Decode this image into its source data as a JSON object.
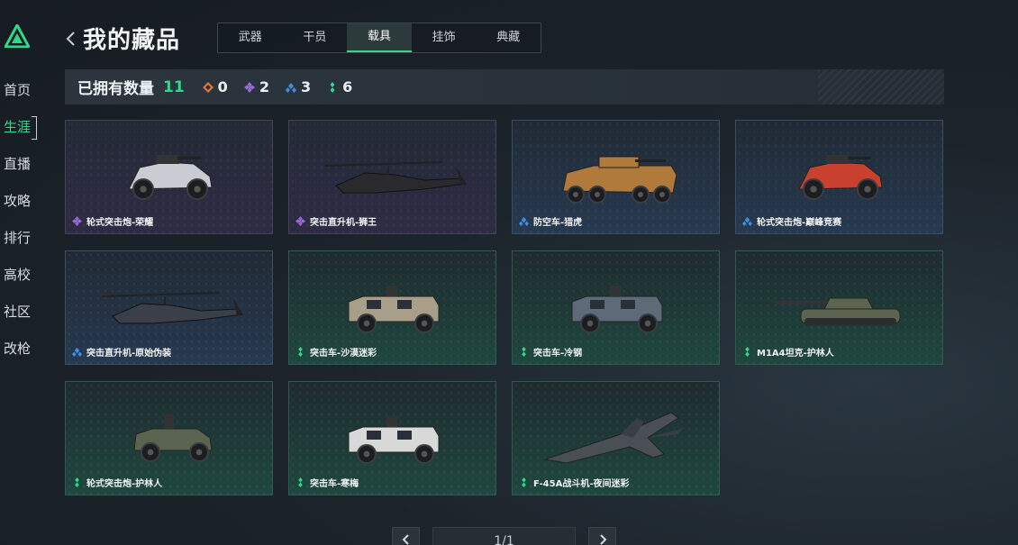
{
  "app": {
    "title": "我的藏品"
  },
  "sidebar": {
    "items": [
      {
        "label": "首页",
        "active": false
      },
      {
        "label": "生涯",
        "active": true
      },
      {
        "label": "直播",
        "active": false
      },
      {
        "label": "攻略",
        "active": false
      },
      {
        "label": "排行",
        "active": false
      },
      {
        "label": "高校",
        "active": false
      },
      {
        "label": "社区",
        "active": false
      },
      {
        "label": "改枪",
        "active": false
      }
    ]
  },
  "tabs": [
    {
      "label": "武器",
      "active": false
    },
    {
      "label": "干员",
      "active": false
    },
    {
      "label": "载具",
      "active": true
    },
    {
      "label": "挂饰",
      "active": false
    },
    {
      "label": "典藏",
      "active": false
    }
  ],
  "summary": {
    "owned_label": "已拥有数量",
    "owned_count": "11",
    "rarities": [
      {
        "icon": "orange-diamond-icon",
        "color": "#e2773a",
        "count": "0"
      },
      {
        "icon": "purple-diamond-icon",
        "color": "#9a6bd8",
        "count": "2"
      },
      {
        "icon": "blue-diamond-icon",
        "color": "#3f8ee0",
        "count": "3"
      },
      {
        "icon": "green-diamond-icon",
        "color": "#2fd88a",
        "count": "6"
      }
    ]
  },
  "items": [
    {
      "name": "轮式突击炮-荣耀",
      "rarity": "purple",
      "vehicle": "buggy",
      "palette": "#c9ccd2"
    },
    {
      "name": "突击直升机-狮王",
      "rarity": "purple",
      "vehicle": "helicopter",
      "palette": "#2a2a2e"
    },
    {
      "name": "防空车-猎虎",
      "rarity": "blue",
      "vehicle": "apc",
      "palette": "#b07a3c"
    },
    {
      "name": "轮式突击炮-巅峰竞赛",
      "rarity": "blue",
      "vehicle": "buggy",
      "palette": "#c8402e"
    },
    {
      "name": "突击直升机-原始伪装",
      "rarity": "blue",
      "vehicle": "helicopter",
      "palette": "#3a3f4a"
    },
    {
      "name": "突击车-沙漠迷彩",
      "rarity": "green",
      "vehicle": "truck",
      "palette": "#a89e8a"
    },
    {
      "name": "突击车-冷钢",
      "rarity": "green",
      "vehicle": "truck",
      "palette": "#5d6a78"
    },
    {
      "name": "M1A4坦克-护林人",
      "rarity": "green",
      "vehicle": "tank",
      "palette": "#5c6450"
    },
    {
      "name": "轮式突击炮-护林人",
      "rarity": "green",
      "vehicle": "jeep",
      "palette": "#5a6450"
    },
    {
      "name": "突击车-寒梅",
      "rarity": "green",
      "vehicle": "truck",
      "palette": "#d8d8d8"
    },
    {
      "name": "F-45A战斗机-夜间迷彩",
      "rarity": "green",
      "vehicle": "jet",
      "palette": "#4a4f56"
    }
  ],
  "pagination": {
    "indicator": "1/1"
  },
  "colors": {
    "accent": "#2fd88a",
    "purple": "#9a6bd8",
    "blue": "#3f8ee0",
    "green": "#2fd88a"
  }
}
